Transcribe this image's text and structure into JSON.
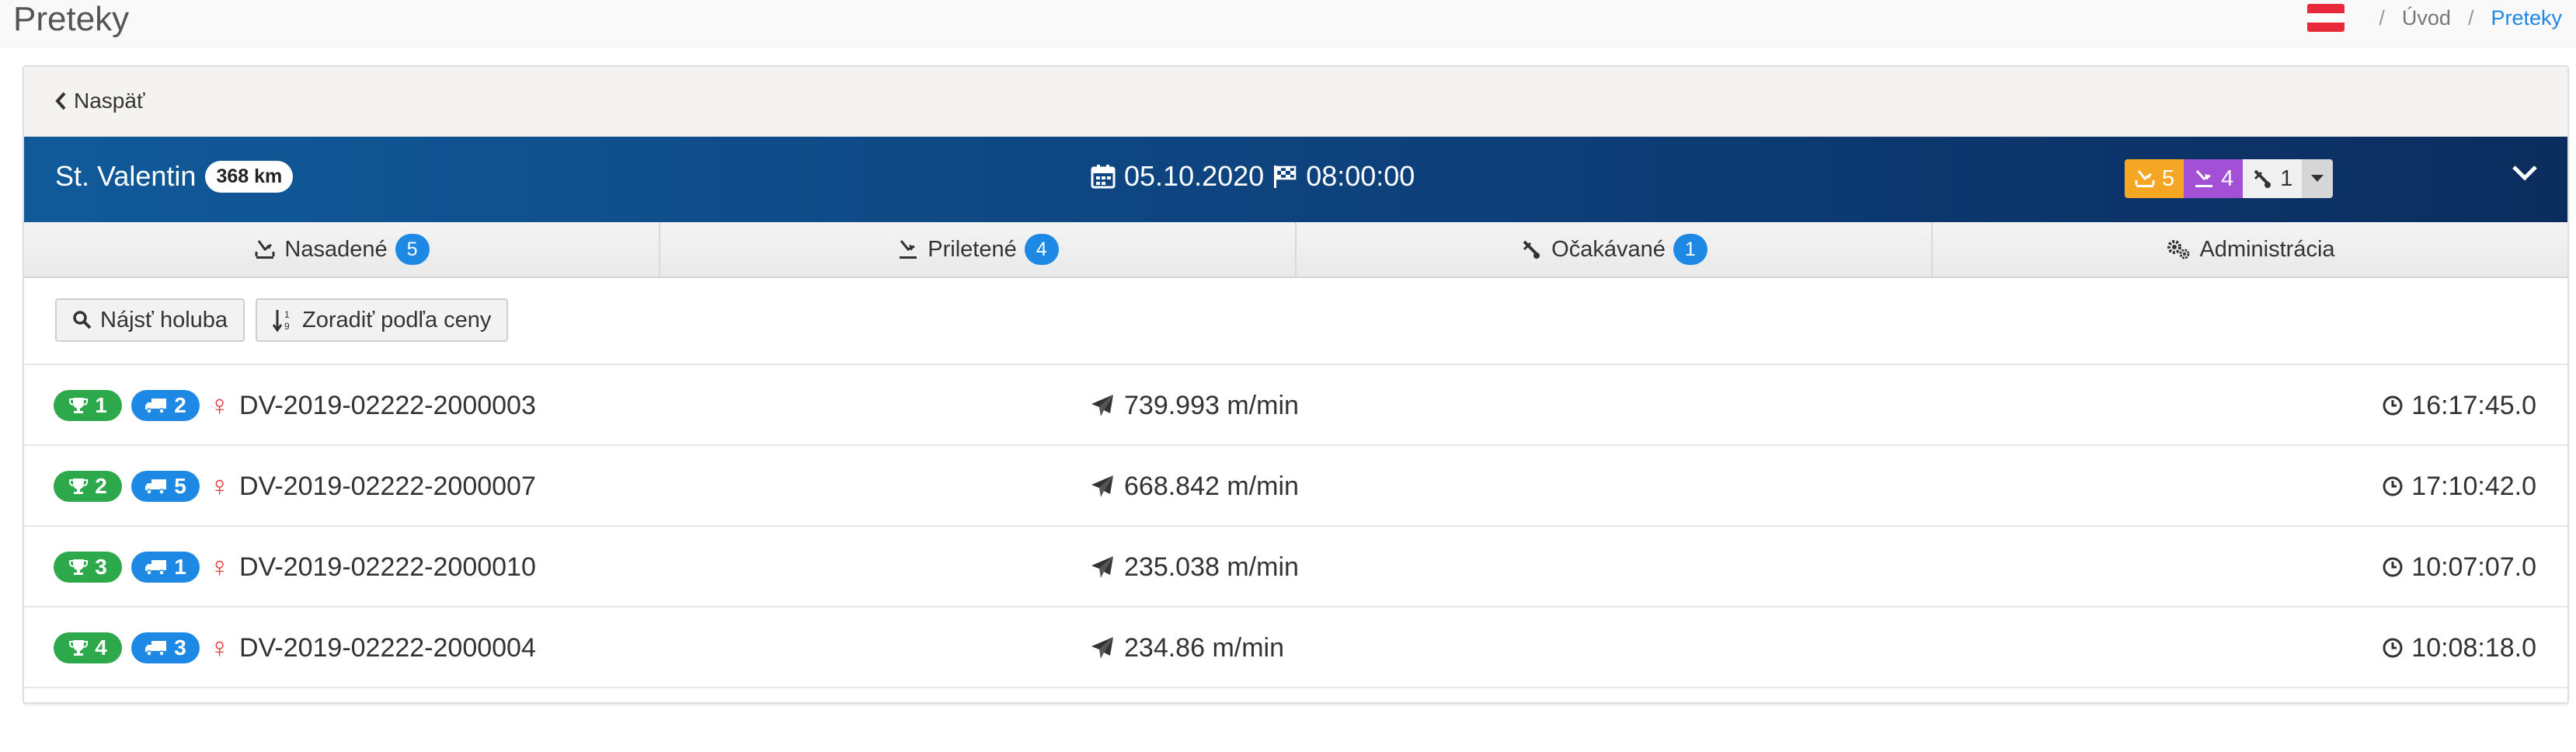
{
  "page": {
    "title": "Preteky"
  },
  "breadcrumb": {
    "sep1": "/",
    "home": "Úvod",
    "sep2": "/",
    "current": "Preteky"
  },
  "back": {
    "label": "Naspäť"
  },
  "race": {
    "name": "St. Valentin",
    "distance": "368 km",
    "date": "05.10.2020",
    "time": "08:00:00",
    "counts": {
      "released": "5",
      "arrived": "4",
      "expected": "1"
    }
  },
  "tabs": [
    {
      "label": "Nasadené",
      "badge": "5",
      "icon": "released-icon"
    },
    {
      "label": "Priletené",
      "badge": "4",
      "icon": "arrived-icon"
    },
    {
      "label": "Očakávané",
      "badge": "1",
      "icon": "expected-icon"
    },
    {
      "label": "Administrácia",
      "icon": "cogs-icon"
    }
  ],
  "toolbar": {
    "find": "Nájsť holuba",
    "sort": "Zoradiť podľa ceny"
  },
  "results": [
    {
      "rank": "1",
      "truck": "2",
      "ring": "DV-2019-02222-2000003",
      "speed": "739.993 m/min",
      "time": "16:17:45.0"
    },
    {
      "rank": "2",
      "truck": "5",
      "ring": "DV-2019-02222-2000007",
      "speed": "668.842 m/min",
      "time": "17:10:42.0"
    },
    {
      "rank": "3",
      "truck": "1",
      "ring": "DV-2019-02222-2000010",
      "speed": "235.038 m/min",
      "time": "10:07:07.0"
    },
    {
      "rank": "4",
      "truck": "3",
      "ring": "DV-2019-02222-2000004",
      "speed": "234.86 m/min",
      "time": "10:08:18.0"
    }
  ],
  "colors": {
    "header_start": "#115a9a",
    "header_end": "#0b2d5e",
    "badge_blue": "#1e88e5",
    "rank_green": "#2da84a",
    "count_orange": "#f5a623",
    "count_purple": "#a34fd6",
    "female_red": "#e53935"
  }
}
